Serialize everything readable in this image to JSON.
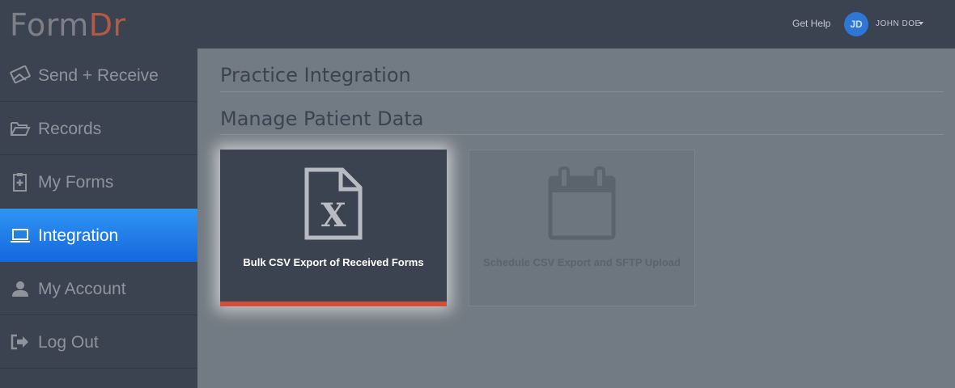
{
  "header": {
    "logo_part1": "Form",
    "logo_part2": "Dr",
    "get_help": "Get Help",
    "avatar_initials": "JD",
    "username": "JOHN DOE"
  },
  "sidebar": {
    "items": [
      {
        "label": "Send + Receive",
        "icon": "send-receive-icon",
        "active": false
      },
      {
        "label": "Records",
        "icon": "folder-open-icon",
        "active": false
      },
      {
        "label": "My Forms",
        "icon": "clipboard-plus-icon",
        "active": false
      },
      {
        "label": "Integration",
        "icon": "laptop-icon",
        "active": true
      },
      {
        "label": "My Account",
        "icon": "user-icon",
        "active": false
      },
      {
        "label": "Log Out",
        "icon": "sign-out-icon",
        "active": false
      }
    ]
  },
  "main": {
    "page_title": "Practice Integration",
    "section_title": "Manage Patient Data",
    "cards": [
      {
        "title": "Bulk CSV Export of Received Forms",
        "icon": "excel-file-icon"
      },
      {
        "title": "Schedule CSV Export and SFTP Upload",
        "icon": "calendar-icon"
      }
    ]
  },
  "colors": {
    "topbar": "#3c4350",
    "active_nav": "#1f7fe8",
    "accent_red": "#d34f35",
    "overlay": "#727a83"
  }
}
